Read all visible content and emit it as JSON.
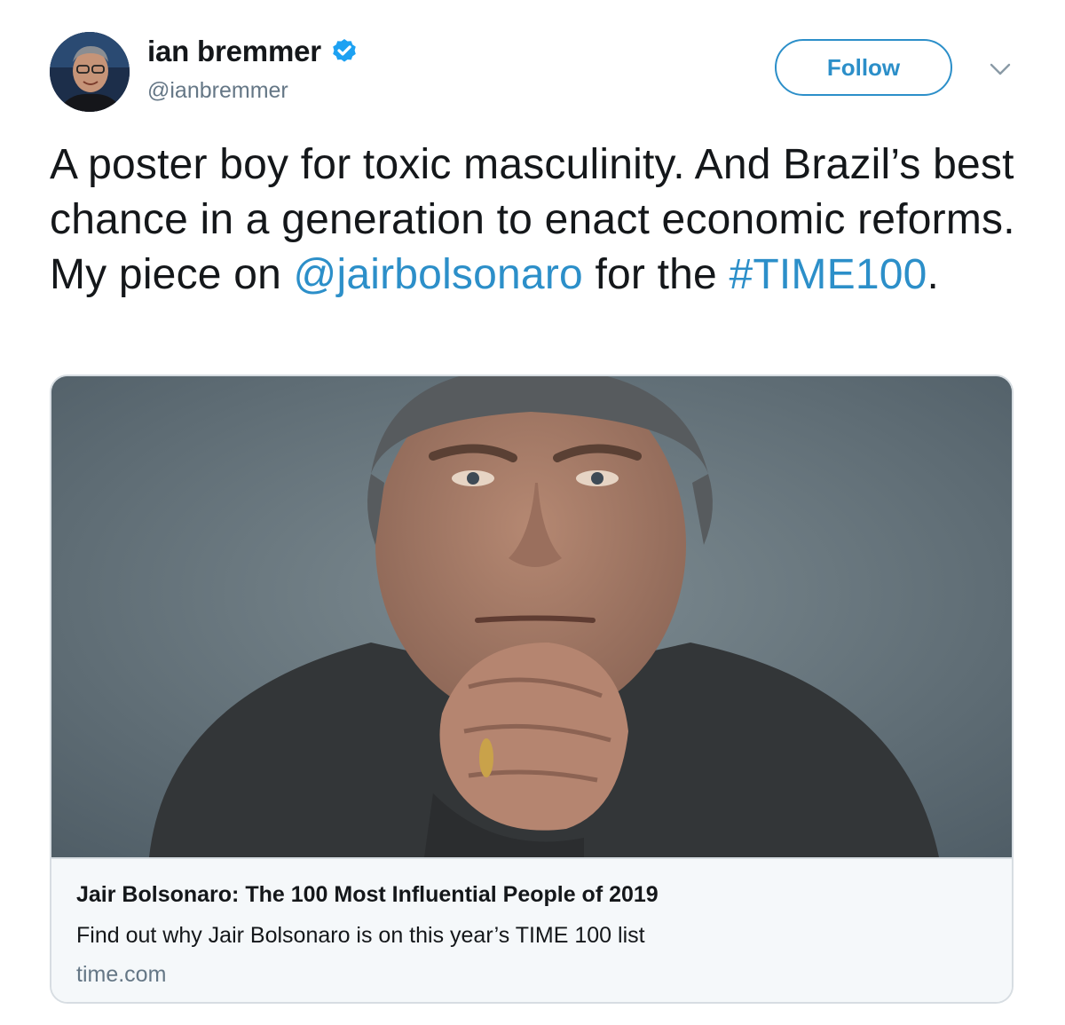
{
  "author": {
    "display_name": "ian bremmer",
    "handle": "@ianbremmer",
    "verified": true
  },
  "actions": {
    "follow_label": "Follow"
  },
  "tweet": {
    "text_part1": "A poster boy for toxic masculinity. And Brazil’s best chance in a generation to enact economic reforms. My piece on ",
    "mention": "@jairbolsonaro",
    "text_part2": " for the ",
    "hashtag": "#TIME100",
    "text_part3": "."
  },
  "card": {
    "title": "Jair Bolsonaro: The 100 Most Influential People of 2019",
    "description": "Find out why Jair Bolsonaro is on this year’s TIME 100 list",
    "domain": "time.com"
  },
  "colors": {
    "link": "#2c8fc9",
    "verified": "#1da1f2",
    "secondary_text": "#657786",
    "card_border": "#d7dde2",
    "card_footer_bg": "#f5f8fa"
  }
}
